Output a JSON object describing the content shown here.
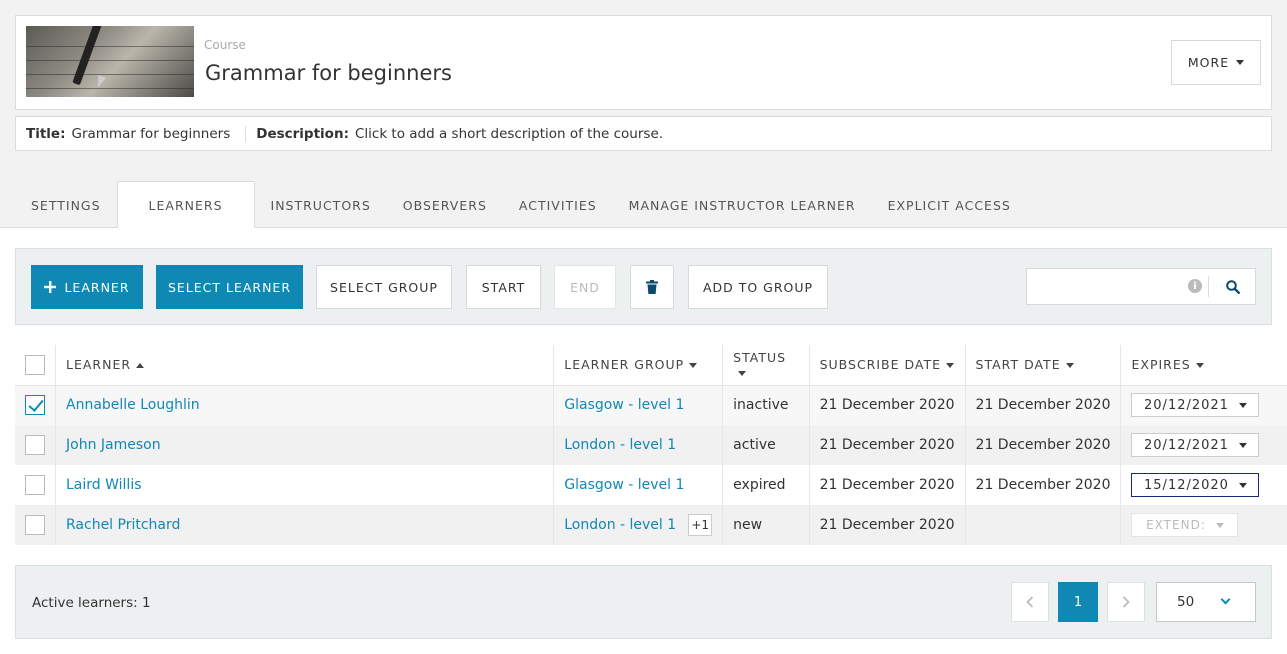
{
  "header": {
    "course_label": "Course",
    "course_title": "Grammar for beginners",
    "more_label": "MORE"
  },
  "meta": {
    "title_key": "Title:",
    "title_value": "Grammar for beginners",
    "description_key": "Description:",
    "description_value": "Click to add a short description of the course."
  },
  "tabs": [
    {
      "label": "SETTINGS"
    },
    {
      "label": "LEARNERS"
    },
    {
      "label": "INSTRUCTORS"
    },
    {
      "label": "OBSERVERS"
    },
    {
      "label": "ACTIVITIES"
    },
    {
      "label": "MANAGE INSTRUCTOR LEARNER"
    },
    {
      "label": "EXPLICIT ACCESS"
    }
  ],
  "toolbar": {
    "add_learner": "LEARNER",
    "select_learner": "SELECT LEARNER",
    "select_group": "SELECT GROUP",
    "start": "START",
    "end": "END",
    "delete_icon": "trash-icon",
    "add_to_group": "ADD TO GROUP",
    "search_placeholder": ""
  },
  "table": {
    "headers": {
      "learner": "LEARNER",
      "learner_group": "LEARNER GROUP",
      "status": "STATUS",
      "subscribe_date": "SUBSCRIBE DATE",
      "start_date": "START DATE",
      "expires": "EXPIRES"
    },
    "rows": [
      {
        "name": "Annabelle Loughlin",
        "group": "Glasgow - level 1",
        "status": "inactive",
        "subscribe": "21 December 2020",
        "start": "21 December 2020",
        "expires": "20/12/2021"
      },
      {
        "name": "John Jameson",
        "group": "London - level 1",
        "status": "active",
        "subscribe": "21 December 2020",
        "start": "21 December 2020",
        "expires": "20/12/2021"
      },
      {
        "name": "Laird Willis",
        "group": "Glasgow - level 1",
        "status": "expired",
        "subscribe": "21 December 2020",
        "start": "21 December 2020",
        "expires": "15/12/2020"
      },
      {
        "name": "Rachel Pritchard",
        "group": "London - level 1",
        "group_extra": "+1",
        "status": "new",
        "subscribe": "21 December 2020",
        "start": "",
        "expires": "EXTEND:"
      }
    ]
  },
  "footer": {
    "active_learners": "Active learners: 1",
    "current_page": "1",
    "per_page": "50"
  },
  "colors": {
    "primary": "#0f88b4",
    "toolbar_bg": "#edf0f1"
  }
}
